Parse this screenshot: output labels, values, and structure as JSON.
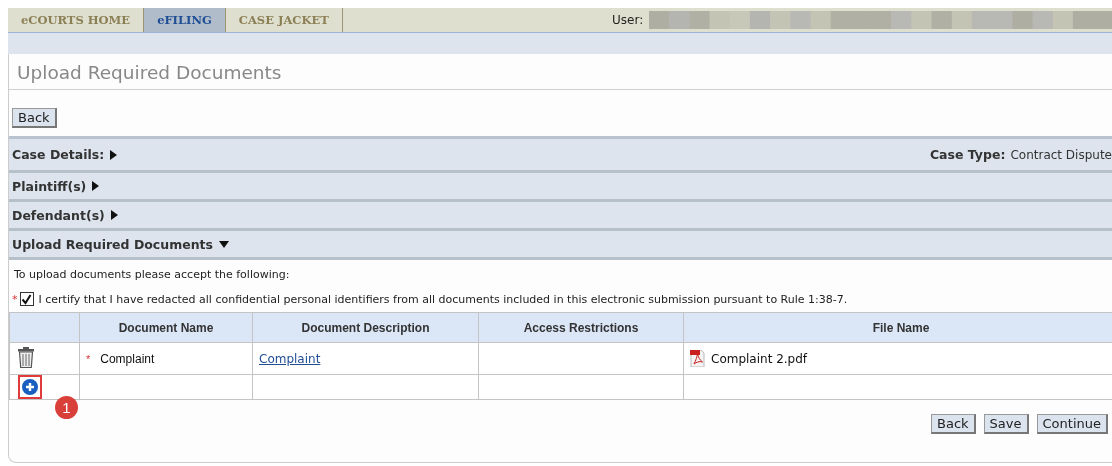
{
  "tabs": [
    {
      "label": "eCOURTS HOME",
      "selected": false
    },
    {
      "label": "eFILING",
      "selected": true
    },
    {
      "label": "CASE JACKET",
      "selected": false
    }
  ],
  "user": {
    "label": "User:"
  },
  "page_title": "Upload Required Documents",
  "top_buttons": [
    "Back"
  ],
  "sections": [
    {
      "title": "Case Details:",
      "expanded": false,
      "detail_label": "Case Type:",
      "detail_value": "Contract Dispute"
    },
    {
      "title": "Plaintiff(s)",
      "expanded": false
    },
    {
      "title": "Defendant(s)",
      "expanded": false
    },
    {
      "title": "Upload Required Documents",
      "expanded": true
    }
  ],
  "instructions": "To upload documents please accept the following:",
  "certification": {
    "required_mark": "*",
    "checked": true,
    "text": "I certify that I have redacted all confidential personal identifiers from all documents included in this electronic submission pursuant to Rule 1:38-7."
  },
  "table": {
    "columns": [
      "Document Name",
      "Document Description",
      "Access Restrictions",
      "File Name"
    ],
    "rows": [
      {
        "kind": "document",
        "required_mark": "*",
        "name": "Complaint",
        "description": "Complaint",
        "file_name": "Complaint 2.pdf"
      },
      {
        "kind": "add"
      }
    ]
  },
  "callout": {
    "number": "1"
  },
  "bottom_buttons": [
    "Back",
    "Save",
    "Continue"
  ]
}
